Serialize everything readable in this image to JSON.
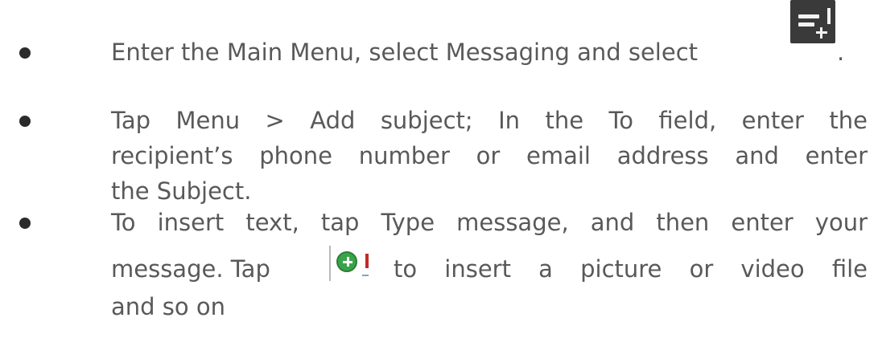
{
  "instructions": [
    {
      "lines": [
        "Enter the Main Menu, select Messaging and select",
        "."
      ],
      "icon": "compose-message-icon"
    },
    {
      "lines": [
        "Tap Menu > Add subject; In the To field, enter the",
        "recipient’s phone number or email address and enter",
        "the Subject."
      ]
    },
    {
      "lines": [
        "To insert text, tap Type message, and then enter your",
        "message. Tap",
        "to insert a picture or video file",
        "and so on"
      ],
      "icon": "attach-plus-icon"
    }
  ],
  "colors": {
    "text": "#595959",
    "bullet": "#2b2b2b",
    "attach_icon_green": "#3aa34a",
    "compose_icon_bg": "#3a3a3a"
  }
}
